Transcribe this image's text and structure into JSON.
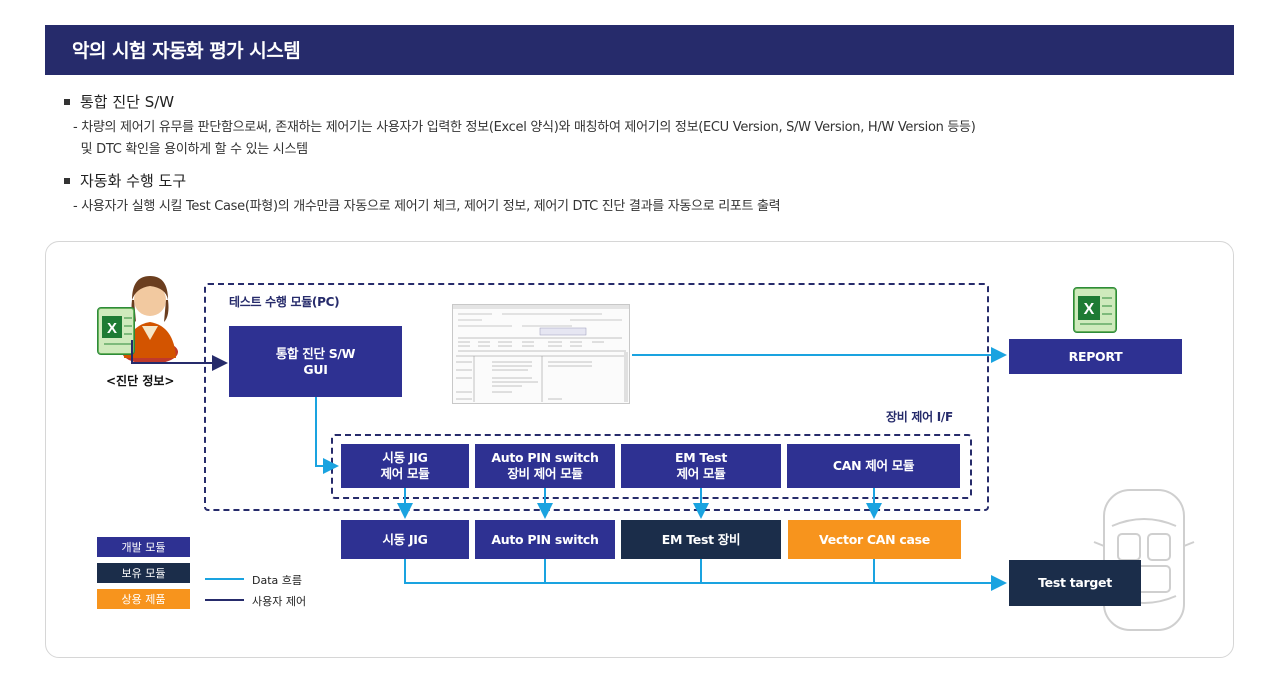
{
  "header": {
    "title": "악의 시험 자동화 평가 시스템"
  },
  "bullets": [
    {
      "title": "통합 진단 S/W",
      "lines": [
        "- 차량의 제어기 유무를 판단함으로써, 존재하는 제어기는 사용자가 입력한 정보(Excel 양식)와 매칭하여 제어기의 정보(ECU Version, S/W Version, H/W Version 등등)",
        "  및 DTC 확인을 용이하게 할 수 있는 시스템"
      ]
    },
    {
      "title": "자동화 수행 도구",
      "lines": [
        "- 사용자가 실행 시킬 Test Case(파형)의 개수만큼 자동으로 제어기 체크, 제어기 정보, 제어기 DTC 진단 결과를 자동으로 리포트 출력"
      ]
    }
  ],
  "diagram": {
    "diag_info_label": "<진단 정보>",
    "test_module_label": "테스트 수행 모듈(PC)",
    "gui_box": "통합 진단 S/W\nGUI",
    "report_box": "REPORT",
    "equip_if_label": "장비 제어 I/F",
    "ctrl_modules": [
      "시동 JIG\n제어 모듈",
      "Auto PIN switch\n장비 제어 모듈",
      "EM Test\n제어 모듈",
      "CAN 제어 모듈"
    ],
    "devices": [
      "시동 JIG",
      "Auto PIN switch",
      "EM Test 장비",
      "Vector CAN case"
    ],
    "test_target": "Test target"
  },
  "legend": {
    "items": [
      {
        "label": "개발 모듈",
        "color": "#2e3192"
      },
      {
        "label": "보유 모듈",
        "color": "#1b2d4a"
      },
      {
        "label": "상용 제품",
        "color": "#f7941d"
      }
    ],
    "lines": [
      {
        "label": "Data 흐름",
        "color": "#1aa3e0"
      },
      {
        "label": "사용자 제어",
        "color": "#262b6b"
      }
    ]
  },
  "colors": {
    "header": "#262b6b",
    "dev": "#2e3192",
    "own": "#1b2d4a",
    "com": "#f7941d",
    "data_line": "#1aa3e0"
  }
}
